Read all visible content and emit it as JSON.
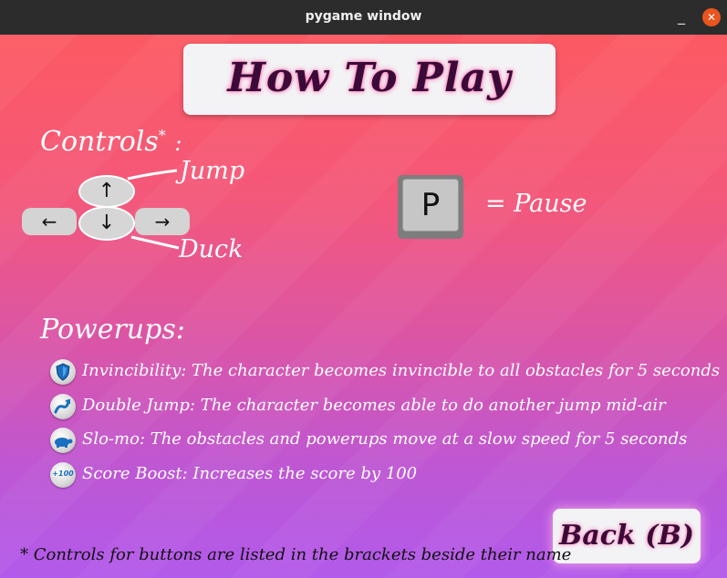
{
  "window": {
    "title": "pygame window",
    "minimize_glyph": "_",
    "close_glyph": "✕"
  },
  "screen": {
    "title": "How To Play",
    "controls": {
      "heading": "Controls",
      "heading_mark": "*",
      "heading_suffix": ":",
      "keys": {
        "up": "↑",
        "down": "↓",
        "left": "←",
        "right": "→"
      },
      "jump_label": "Jump",
      "duck_label": "Duck",
      "pause_key": "P",
      "pause_label": "= Pause"
    },
    "powerups": {
      "heading": "Powerups:",
      "items": [
        {
          "icon": "shield-icon",
          "text": "Invincibility: The character becomes invincible to all obstacles for 5 seconds"
        },
        {
          "icon": "double-jump-icon",
          "text": "Double Jump: The character becomes able to do another jump mid-air"
        },
        {
          "icon": "turtle-icon",
          "text": "Slo-mo: The obstacles and powerups move at a slow speed for 5 seconds"
        },
        {
          "icon": "score-boost-icon",
          "text": "Score Boost: Increases the score by 100",
          "icon_text": "+100"
        }
      ]
    },
    "back_button": "Back (B)",
    "footnote": "* Controls for buttons are listed in the brackets beside their name"
  },
  "colors": {
    "gradient_top": "#fc5a62",
    "gradient_bottom": "#b25aeb",
    "title_text": "#3a0a38",
    "title_glow": "#ff5fa8",
    "panel_bg": "#f3f3f5",
    "icon_blue": "#1a6fbf"
  }
}
